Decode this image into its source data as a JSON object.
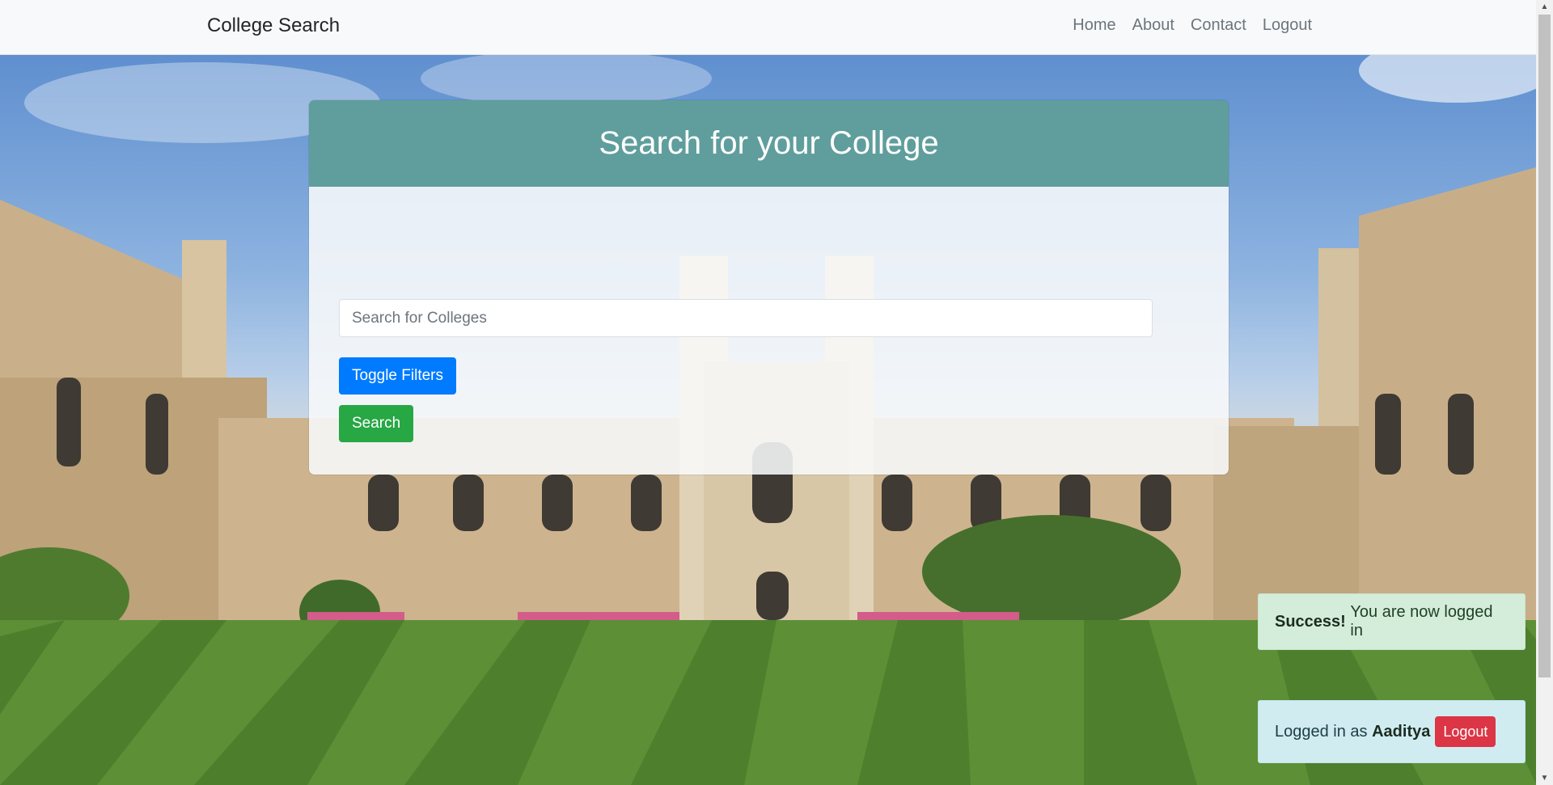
{
  "navbar": {
    "brand": "College Search",
    "links": [
      "Home",
      "About",
      "Contact",
      "Logout"
    ]
  },
  "card": {
    "title": "Search for your College",
    "search_placeholder": "Search for Colleges",
    "toggle_label": "Toggle Filters",
    "search_label": "Search"
  },
  "toast_success": {
    "strong": "Success!",
    "message": "You are now logged in"
  },
  "toast_user": {
    "prefix": "Logged in as",
    "username": "Aaditya",
    "logout_label": "Logout"
  },
  "colors": {
    "header": "#5f9e9c",
    "primary": "#007bff",
    "success": "#28a745",
    "danger": "#dc3545"
  }
}
